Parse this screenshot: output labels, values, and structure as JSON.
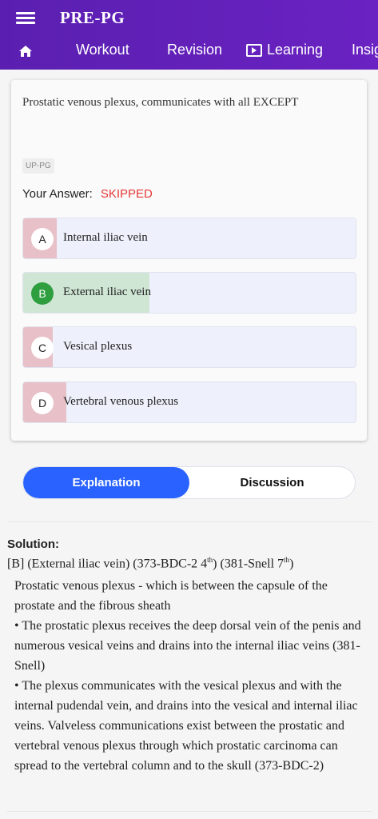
{
  "app": {
    "title": "PRE-PG"
  },
  "tabs": [
    {
      "label": "Workout"
    },
    {
      "label": "Revision"
    },
    {
      "label": "Learning"
    },
    {
      "label": "Insig"
    }
  ],
  "question": {
    "text": "Prostatic venous plexus, communicates with all EXCEPT",
    "tag": "UP-PG",
    "your_answer_label": "Your Answer:",
    "your_answer_value": "SKIPPED"
  },
  "options": [
    {
      "letter": "A",
      "text": "Internal iliac vein",
      "percent": 10
    },
    {
      "letter": "B",
      "text": "External iliac vein",
      "percent": 38,
      "correct": true
    },
    {
      "letter": "C",
      "text": "Vesical plexus",
      "percent": 9
    },
    {
      "letter": "D",
      "text": "Vertebral venous plexus",
      "percent": 13
    }
  ],
  "toggle": {
    "explanation": "Explanation",
    "discussion": "Discussion"
  },
  "solution": {
    "title": "Solution:",
    "ref_main": "[B] (External iliac vein) (373-BDC-2 4",
    "ref_sup1": "th",
    "ref_mid": ") (381-Snell 7",
    "ref_sup2": "th",
    "ref_end": ")",
    "para1": "Prostatic venous plexus - which is between the capsule of the prostate and the fibrous sheath",
    "para2": "•  The prostatic plexus receives the deep dorsal vein of the penis and numerous vesical veins and drains into the internal iliac veins (381-Snell)",
    "para3": "•  The plexus communicates with the vesical plexus and with the internal pudendal vein, and drains into the vesical and internal iliac veins. Valveless communications exist between the prostatic and vertebral venous plexus through which prostatic carcinoma can spread to the vertebral column and to the skull (373-BDC-2)"
  },
  "colors": {
    "header": "#5a1fb0",
    "wrong_fill": "#e8c0c8",
    "correct_fill": "#cfe6d5",
    "correct_badge": "#2e9e3f",
    "skipped": "#e53935",
    "toggle_active": "#2962ff"
  }
}
